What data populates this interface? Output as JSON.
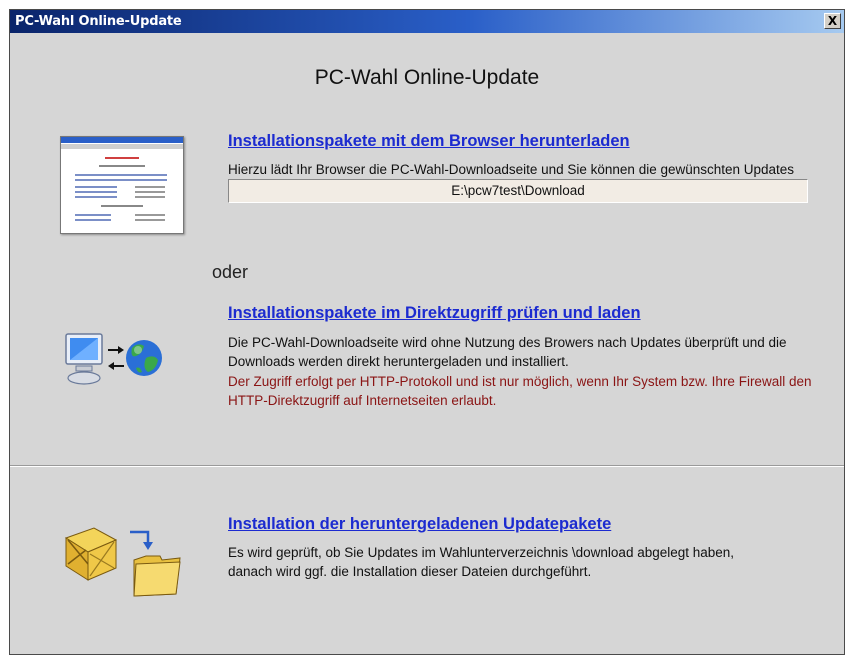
{
  "window": {
    "title": "PC-Wahl Online-Update",
    "close_label": "X"
  },
  "heading": "PC-Wahl Online-Update",
  "section_browser": {
    "link": "Installationspakete mit dem Browser herunterladen",
    "text": "Hierzu lädt Ihr Browser die PC-Wahl-Downloadseite und Sie können die  gewünschten Updates herunterladen. Bitte legen Sie die Updatedateien in folgendem Verzeichnis ab:",
    "path": "E:\\pcw7test\\Download",
    "icon": "browser-screenshot-icon"
  },
  "or_label": "oder",
  "section_direct": {
    "link": "Installationspakete im Direktzugriff prüfen und laden",
    "text": "Die PC-Wahl-Downloadseite wird ohne Nutzung des Browers nach Updates überprüft und die Downloads werden direkt heruntergeladen und installiert.",
    "warning": "Der Zugriff erfolgt per HTTP-Protokoll und ist nur möglich, wenn Ihr System bzw. Ihre Firewall den HTTP-Direktzugriff auf Internetseiten erlaubt.",
    "icon": "computer-globe-icon"
  },
  "section_install": {
    "link": "Installation der heruntergeladenen Updatepakete",
    "text": "Es wird geprüft, ob Sie Updates im Wahlunterverzeichnis \\download abgelegt haben, danach wird ggf. die Installation dieser Dateien durchgeführt.",
    "icon": "package-folder-icon"
  },
  "colors": {
    "link": "#1c2bd0",
    "warning": "#8a1414",
    "background": "#d6d6d6",
    "title_bar": "#0a246a"
  }
}
